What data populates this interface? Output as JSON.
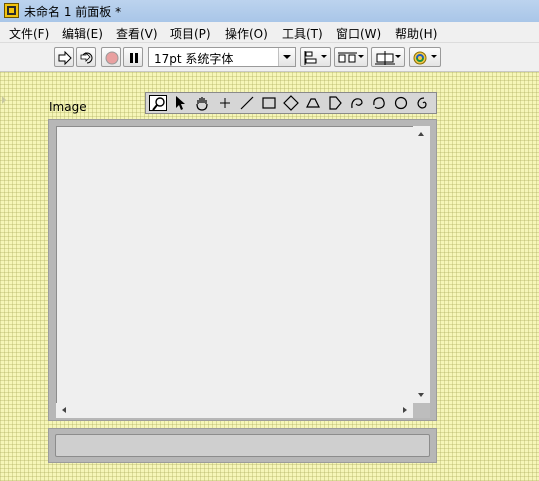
{
  "window": {
    "title": "未命名 1 前面板 *"
  },
  "menu": {
    "items": [
      "文件(F)",
      "编辑(E)",
      "查看(V)",
      "项目(P)",
      "操作(O)",
      "工具(T)",
      "窗口(W)",
      "帮助(H)"
    ]
  },
  "toolbar": {
    "font": "17pt 系统字体",
    "buttons": [
      "run-arrow-icon",
      "run-continuously-icon",
      "abort-icon",
      "pause-icon",
      "align-objects-icon",
      "distribute-objects-icon",
      "resize-objects-icon",
      "reorder-icon"
    ]
  },
  "panel": {
    "image_control_label": "Image",
    "palette_tools": [
      "zoom-icon",
      "pointer-icon",
      "pan-hand-icon",
      "point-icon",
      "line-icon",
      "rectangle-icon",
      "rotated-rectangle-icon",
      "annulus-icon",
      "broken-line-icon",
      "freehand-line-icon",
      "polygon-icon",
      "oval-icon",
      "spiral-icon"
    ]
  },
  "colors": {
    "panel_bg": "#f6f6b8",
    "titlebar": "#bcd3ee",
    "frame": "#b7b7b7"
  }
}
